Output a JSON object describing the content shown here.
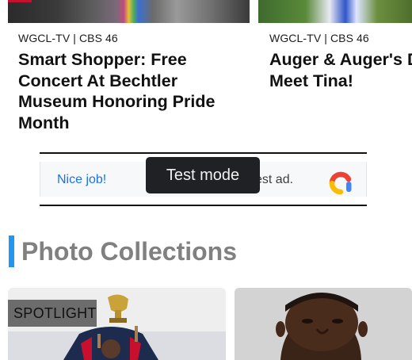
{
  "cards": [
    {
      "source": "WGCL-TV | CBS 46",
      "headline_lines": [
        "Smart Shopper: Free",
        "Concert At Bechtler",
        "Museum Honoring Pride",
        "Month"
      ]
    },
    {
      "source": "WGCL-TV | CBS 46",
      "headline_lines": [
        "Auger & Auger's D",
        "Meet Tina!"
      ]
    }
  ],
  "ad": {
    "left_text": "Nice job!",
    "right_text": "est ad.",
    "logo_icon": "google-ads-logo-icon"
  },
  "toast": {
    "text": "Test mode"
  },
  "section": {
    "title": "Photo Collections",
    "accent_color": "#2196f3"
  },
  "photos": [
    {
      "badge": "SPOTLIGHT"
    },
    {
      "badge": ""
    }
  ]
}
